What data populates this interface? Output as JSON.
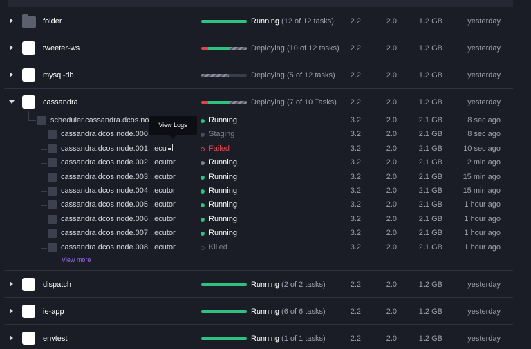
{
  "services": [
    {
      "name": "folder",
      "type": "folder",
      "status_bold": "Running",
      "status_rest": " (12 of 12 tasks)",
      "cpu": "2.2",
      "mem": "2.0",
      "disk": "1.2 GB",
      "updated": "yesterday"
    },
    {
      "name": "tweeter-ws",
      "type": "service",
      "status_bold": "",
      "status_rest": "Deploying (10 of 12 tasks)",
      "cpu": "2.2",
      "mem": "2.0",
      "disk": "1.2 GB",
      "updated": "yesterday"
    },
    {
      "name": "mysql-db",
      "type": "service",
      "status_bold": "",
      "status_rest": "Deploying (5 of 12 tasks)",
      "cpu": "2.2",
      "mem": "2.0",
      "disk": "1.2 GB",
      "updated": "yesterday"
    },
    {
      "name": "cassandra",
      "type": "service",
      "status_bold": "",
      "status_rest": "Deploying (7 of 10 Tasks)",
      "cpu": "2.2",
      "mem": "2.0",
      "disk": "1.2 GB",
      "updated": "yesterday"
    },
    {
      "name": "dispatch",
      "type": "service",
      "status_bold": "Running",
      "status_rest": " (2 of 2 tasks)",
      "cpu": "2.2",
      "mem": "2.0",
      "disk": "1.2 GB",
      "updated": "yesterday"
    },
    {
      "name": "ie-app",
      "type": "service",
      "status_bold": "Running",
      "status_rest": " (6 of 6 tasks)",
      "cpu": "2.2",
      "mem": "2.0",
      "disk": "1.2 GB",
      "updated": "yesterday"
    },
    {
      "name": "envtest",
      "type": "service",
      "status_bold": "Running",
      "status_rest": " (1 of 1 tasks)",
      "cpu": "2.2",
      "mem": "2.0",
      "disk": "1.2 GB",
      "updated": "yesterday"
    }
  ],
  "progress": [
    {
      "running": 1.0,
      "failed": 0.0,
      "deploying": 0.0
    },
    {
      "running": 0.45,
      "failed": 0.15,
      "deploying": 0.4
    },
    {
      "running": 0.0,
      "failed": 0.0,
      "deploying": 0.6
    },
    {
      "running": 0.45,
      "failed": 0.15,
      "deploying": 0.4
    },
    {
      "running": 1.0,
      "failed": 0.0,
      "deploying": 0.0
    },
    {
      "running": 1.0,
      "failed": 0.0,
      "deploying": 0.0
    },
    {
      "running": 1.0,
      "failed": 0.0,
      "deploying": 0.0
    }
  ],
  "tasks": [
    {
      "name": "scheduler.cassandra.dcos.noc",
      "status": "Running",
      "state": "running",
      "cpu": "3.2",
      "mem": "2.0",
      "disk": "2.1 GB",
      "updated": "8 sec ago"
    },
    {
      "name": "cassandra.dcos.node.000.",
      "status": "Staging",
      "state": "staging",
      "cpu": "3.2",
      "mem": "2.0",
      "disk": "2.1 GB",
      "updated": "8 sec ago"
    },
    {
      "name": "cassandra.dcos.node.001...ecu",
      "status": "Failed",
      "state": "failed",
      "cpu": "3.2",
      "mem": "2.0",
      "disk": "2.1 GB",
      "updated": "10 sec ago"
    },
    {
      "name": "cassandra.dcos.node.002...ecutor",
      "status": "Running",
      "state": "running-grey",
      "cpu": "3.2",
      "mem": "2.0",
      "disk": "2.1 GB",
      "updated": "2 min ago"
    },
    {
      "name": "cassandra.dcos.node.003...ecutor",
      "status": "Running",
      "state": "running",
      "cpu": "3.2",
      "mem": "2.0",
      "disk": "2.1 GB",
      "updated": "15 min ago"
    },
    {
      "name": "cassandra.dcos.node.004...ecutor",
      "status": "Running",
      "state": "running",
      "cpu": "3.2",
      "mem": "2.0",
      "disk": "2.1 GB",
      "updated": "15 min ago"
    },
    {
      "name": "cassandra.dcos.node.005...ecutor",
      "status": "Running",
      "state": "running",
      "cpu": "3.2",
      "mem": "2.0",
      "disk": "2.1 GB",
      "updated": "1 hour ago"
    },
    {
      "name": "cassandra.dcos.node.006...ecutor",
      "status": "Running",
      "state": "running",
      "cpu": "3.2",
      "mem": "2.0",
      "disk": "2.1 GB",
      "updated": "1 hour ago"
    },
    {
      "name": "cassandra.dcos.node.007...ecutor",
      "status": "Running",
      "state": "running",
      "cpu": "3.2",
      "mem": "2.0",
      "disk": "2.1 GB",
      "updated": "1 hour ago"
    },
    {
      "name": "cassandra.dcos.node.008...ecutor",
      "status": "Killed",
      "state": "killed",
      "cpu": "3.2",
      "mem": "2.0",
      "disk": "2.1 GB",
      "updated": "1 hour ago"
    }
  ],
  "tooltip": "View Logs",
  "view_more": "View more",
  "colors": {
    "background": "#1b1d26",
    "running": "#2ec27e",
    "failed": "#e2434b",
    "link": "#9a6bf0"
  }
}
